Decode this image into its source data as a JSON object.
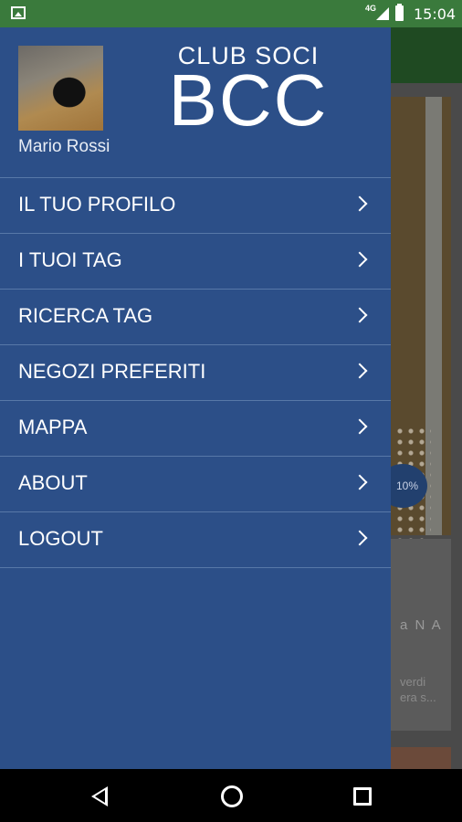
{
  "status_bar": {
    "network": "4G",
    "time": "15:04",
    "icons": [
      "gallery-icon",
      "signal-icon",
      "battery-icon"
    ]
  },
  "drawer": {
    "user_name": "Mario Rossi",
    "logo_top": "CLUB SOCI",
    "logo_main": "BCC",
    "items": [
      {
        "label": "IL TUO PROFILO"
      },
      {
        "label": "I TUOI TAG"
      },
      {
        "label": "RICERCA TAG"
      },
      {
        "label": "NEGOZI PREFERITI"
      },
      {
        "label": "MAPPA"
      },
      {
        "label": "ABOUT"
      },
      {
        "label": "LOGOUT"
      }
    ]
  },
  "background": {
    "badge": "10%",
    "text_1": "a N A",
    "text_2": "verdi\nera s..."
  },
  "colors": {
    "drawer": "#2c4f88",
    "status_bar": "#3a7a3c",
    "divider": "#5878a8"
  }
}
